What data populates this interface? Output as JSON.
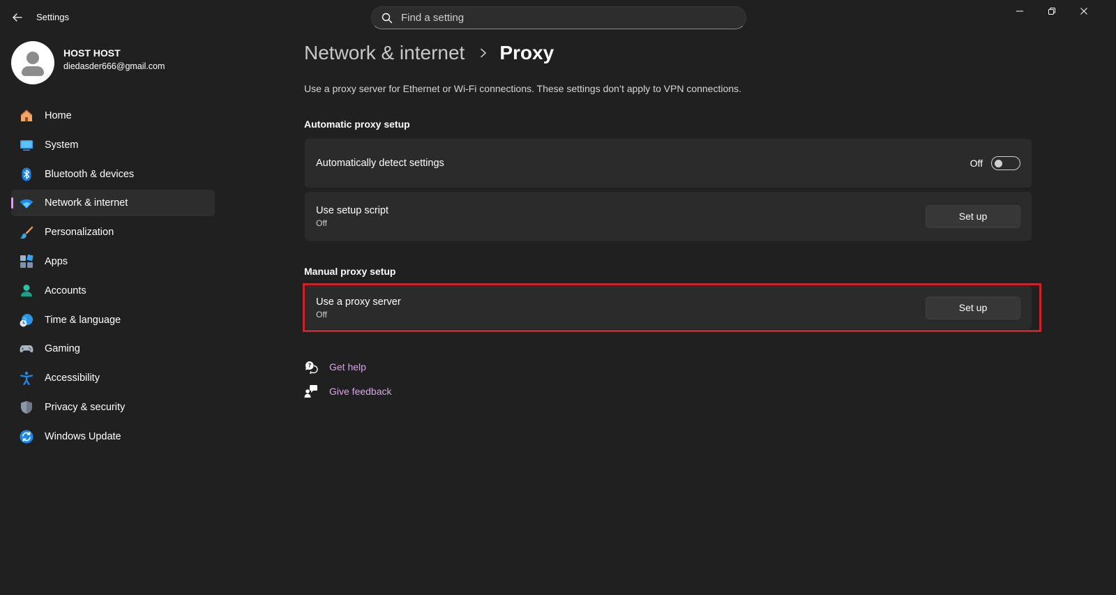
{
  "window": {
    "title": "Settings",
    "controls": [
      "minimize",
      "restore",
      "close"
    ]
  },
  "search": {
    "placeholder": "Find a setting"
  },
  "profile": {
    "name": "HOST HOST",
    "email": "diedasder666@gmail.com"
  },
  "sidebar": {
    "items": [
      {
        "label": "Home",
        "icon": "home-icon"
      },
      {
        "label": "System",
        "icon": "monitor-icon"
      },
      {
        "label": "Bluetooth & devices",
        "icon": "bluetooth-icon"
      },
      {
        "label": "Network & internet",
        "icon": "wifi-icon",
        "active": true
      },
      {
        "label": "Personalization",
        "icon": "brush-icon"
      },
      {
        "label": "Apps",
        "icon": "apps-icon"
      },
      {
        "label": "Accounts",
        "icon": "person-icon"
      },
      {
        "label": "Time & language",
        "icon": "globe-clock-icon"
      },
      {
        "label": "Gaming",
        "icon": "gamepad-icon"
      },
      {
        "label": "Accessibility",
        "icon": "accessibility-icon"
      },
      {
        "label": "Privacy & security",
        "icon": "shield-icon"
      },
      {
        "label": "Windows Update",
        "icon": "update-icon"
      }
    ]
  },
  "page": {
    "breadcrumb_parent": "Network & internet",
    "breadcrumb_current": "Proxy",
    "description": "Use a proxy server for Ethernet or Wi-Fi connections. These settings don’t apply to VPN connections."
  },
  "automatic": {
    "section_title": "Automatic proxy setup",
    "detect": {
      "title": "Automatically detect settings",
      "state_label": "Off",
      "on": false
    },
    "script": {
      "title": "Use setup script",
      "subtitle": "Off",
      "button": "Set up"
    }
  },
  "manual": {
    "section_title": "Manual proxy setup",
    "proxy": {
      "title": "Use a proxy server",
      "subtitle": "Off",
      "button": "Set up"
    }
  },
  "help": {
    "get_help": "Get help",
    "give_feedback": "Give feedback"
  },
  "colors": {
    "background": "#202020",
    "card": "#2b2b2b",
    "accent": "#d4a6e0",
    "highlight": "#d0202a",
    "link": "#d6a5e6"
  }
}
